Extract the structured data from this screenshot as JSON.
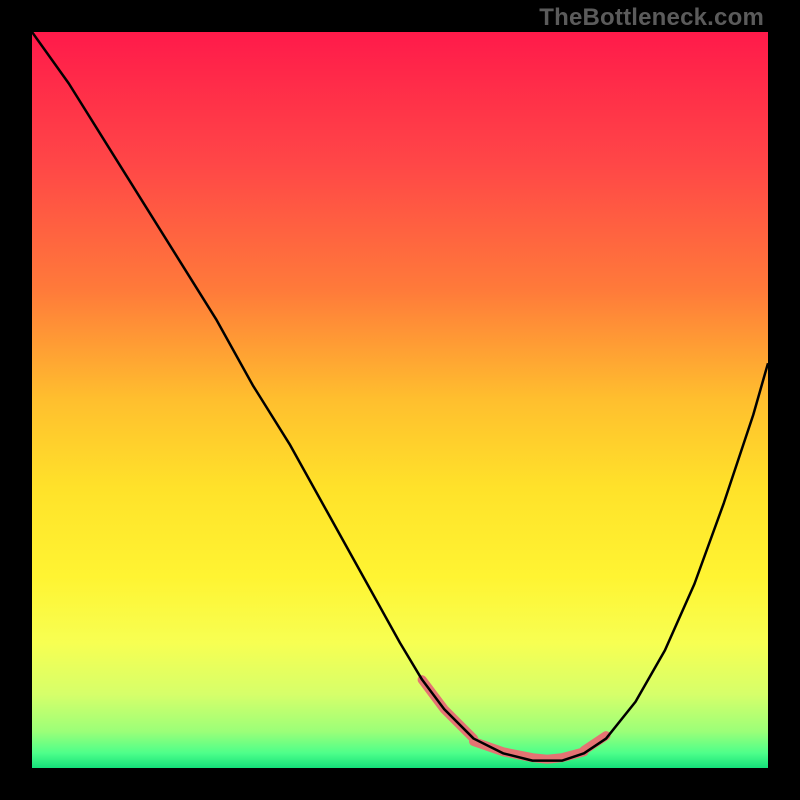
{
  "watermark": {
    "text": "TheBottleneck.com"
  },
  "chart_data": {
    "type": "line",
    "title": "",
    "xlabel": "",
    "ylabel": "",
    "xlim": [
      0,
      100
    ],
    "ylim": [
      0,
      100
    ],
    "grid": false,
    "legend": false,
    "gradient_stops": [
      {
        "pct": 0,
        "color": "#ff1a4a"
      },
      {
        "pct": 18,
        "color": "#ff4747"
      },
      {
        "pct": 35,
        "color": "#ff7a3a"
      },
      {
        "pct": 50,
        "color": "#ffbf2e"
      },
      {
        "pct": 62,
        "color": "#ffe22a"
      },
      {
        "pct": 74,
        "color": "#fff432"
      },
      {
        "pct": 83,
        "color": "#f7ff52"
      },
      {
        "pct": 90,
        "color": "#d6ff6a"
      },
      {
        "pct": 95,
        "color": "#9cff78"
      },
      {
        "pct": 98,
        "color": "#4dff8a"
      },
      {
        "pct": 100,
        "color": "#14e07a"
      }
    ],
    "series": [
      {
        "name": "curve",
        "color": "#000000",
        "width": 2.5,
        "x": [
          0,
          5,
          10,
          15,
          20,
          25,
          30,
          35,
          40,
          45,
          50,
          53,
          56,
          60,
          64,
          68,
          70,
          72,
          75,
          78,
          82,
          86,
          90,
          94,
          98,
          100
        ],
        "y": [
          100,
          93,
          85,
          77,
          69,
          61,
          52,
          44,
          35,
          26,
          17,
          12,
          8,
          4,
          2,
          1,
          1,
          1,
          2,
          4,
          9,
          16,
          25,
          36,
          48,
          55
        ]
      },
      {
        "name": "highlight-segments",
        "color": "#e57373",
        "width": 9,
        "linecap": "round",
        "segments": [
          {
            "x": [
              53,
              56,
              60
            ],
            "y": [
              12,
              8,
              4
            ]
          },
          {
            "x": [
              60,
              64,
              68,
              70,
              72,
              75
            ],
            "y": [
              3.6,
              2.2,
              1.4,
              1.2,
              1.4,
              2.2
            ]
          },
          {
            "x": [
              75,
              78
            ],
            "y": [
              2.4,
              4.4
            ]
          }
        ]
      }
    ]
  }
}
